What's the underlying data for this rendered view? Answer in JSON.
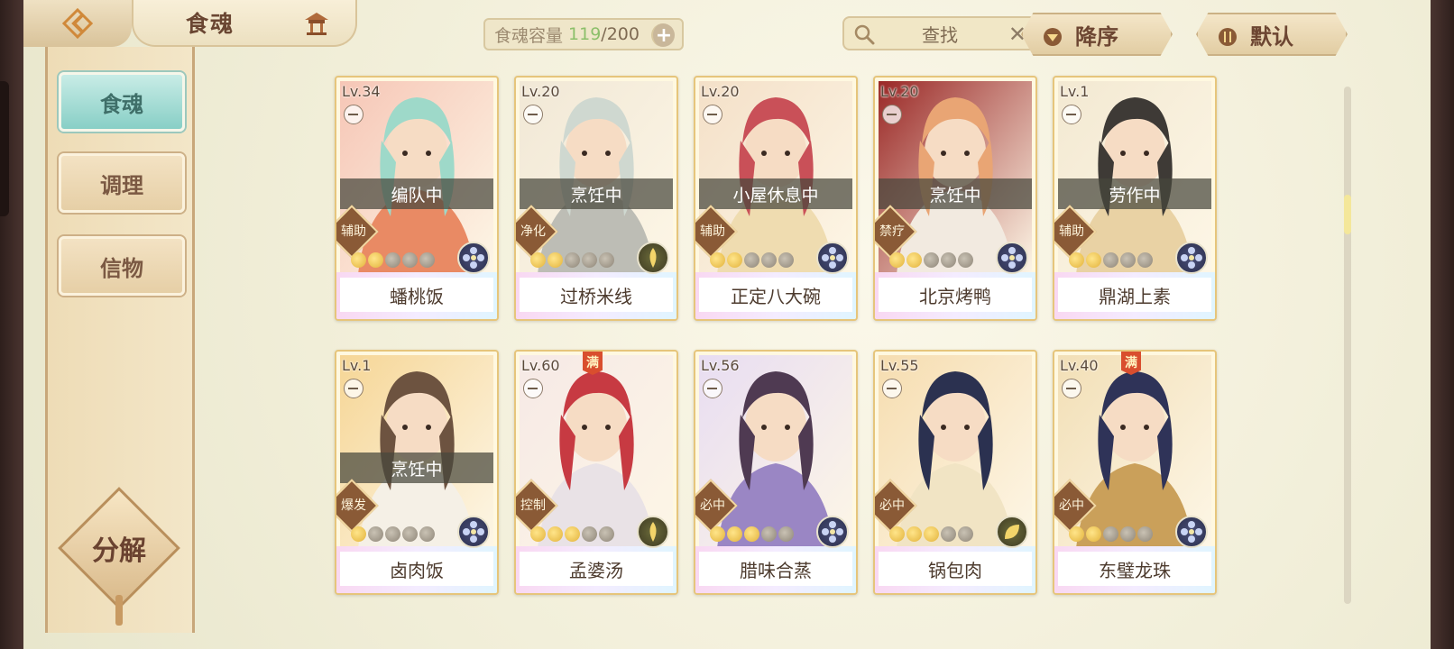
{
  "header": {
    "title": "食魂",
    "capacity_label": "食魂容量",
    "capacity_current": "119",
    "capacity_sep": "/",
    "capacity_max": "200",
    "search_placeholder": "查找",
    "sort_order_label": "降序",
    "sort_default_label": "默认"
  },
  "sidebar": {
    "items": [
      {
        "label": "食魂",
        "active": true
      },
      {
        "label": "调理",
        "active": false
      },
      {
        "label": "信物",
        "active": false
      }
    ],
    "decompose_label": "分解"
  },
  "cards": [
    {
      "level": "Lv.34",
      "name": "蟠桃饭",
      "status": "编队中",
      "role": "辅助",
      "stars_on": 2,
      "full": false,
      "element": "flower-icon",
      "art": [
        "#f6c6b6",
        "#9ed9c9",
        "#e98a64"
      ]
    },
    {
      "level": "Lv.20",
      "name": "过桥米线",
      "status": "烹饪中",
      "role": "净化",
      "stars_on": 2,
      "full": false,
      "element": "flame-icon",
      "art": [
        "#f1e8d6",
        "#cfd8d0",
        "#bdbdb5"
      ]
    },
    {
      "level": "Lv.20",
      "name": "正定八大碗",
      "status": "小屋休息中",
      "role": "辅助",
      "stars_on": 2,
      "full": false,
      "element": "flower-icon",
      "art": [
        "#f4e0c8",
        "#c95058",
        "#efdcb0"
      ]
    },
    {
      "level": "Lv.20",
      "name": "北京烤鸭",
      "status": "烹饪中",
      "role": "禁疗",
      "stars_on": 2,
      "full": false,
      "element": "flower-icon",
      "art": [
        "#9a2826",
        "#e9a574",
        "#f2eae0"
      ]
    },
    {
      "level": "Lv.1",
      "name": "鼎湖上素",
      "status": "劳作中",
      "role": "辅助",
      "stars_on": 2,
      "full": false,
      "element": "flower-icon",
      "art": [
        "#f3e9d2",
        "#3e3a36",
        "#e9d2a4"
      ]
    },
    {
      "level": "Lv.1",
      "name": "卤肉饭",
      "status": "烹饪中",
      "role": "爆发",
      "stars_on": 1,
      "full": false,
      "element": "flower-icon",
      "art": [
        "#f6d696",
        "#6d5340",
        "#f5f0e6"
      ]
    },
    {
      "level": "Lv.60",
      "name": "孟婆汤",
      "status": "",
      "role": "控制",
      "stars_on": 3,
      "full": true,
      "element": "flame-icon",
      "art": [
        "#f6e9e6",
        "#c73a42",
        "#e9e2e6"
      ]
    },
    {
      "level": "Lv.56",
      "name": "腊味合蒸",
      "status": "",
      "role": "必中",
      "stars_on": 3,
      "full": false,
      "element": "flower-icon",
      "art": [
        "#e8ddf2",
        "#4f3a52",
        "#9a86c4"
      ]
    },
    {
      "level": "Lv.55",
      "name": "锅包肉",
      "status": "",
      "role": "必中",
      "stars_on": 3,
      "full": false,
      "element": "leaf-icon",
      "art": [
        "#f6ddb0",
        "#2b3150",
        "#f1e4c4"
      ]
    },
    {
      "level": "Lv.40",
      "name": "东璧龙珠",
      "status": "",
      "role": "必中",
      "stars_on": 2,
      "full": true,
      "element": "flower-icon",
      "art": [
        "#f2dfb6",
        "#2f3358",
        "#caa05a"
      ]
    }
  ],
  "full_badge": "满",
  "colors": {
    "accent_teal": "#88cfc6",
    "brown_text": "#6a4632",
    "star_on": "#e2b23b",
    "status_overlay": "#46463c"
  }
}
